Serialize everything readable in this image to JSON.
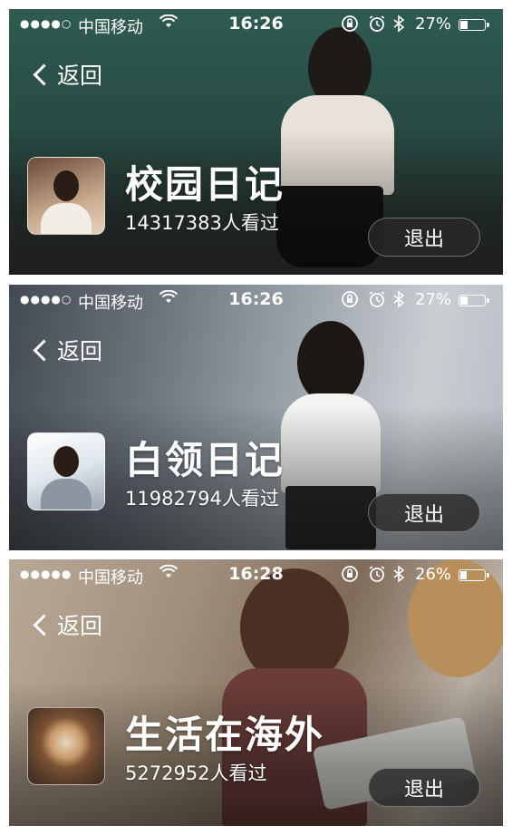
{
  "panels": [
    {
      "status": {
        "carrier": "中国移动",
        "time": "16:26",
        "battery": "27%",
        "battery_level": 0.27,
        "signal_dots": "●●●●○"
      },
      "back_label": "返回",
      "title": "校园日记",
      "views": "14317383人看过",
      "exit_label": "退出"
    },
    {
      "status": {
        "carrier": "中国移动",
        "time": "16:26",
        "battery": "27%",
        "battery_level": 0.27,
        "signal_dots": "●●●●○"
      },
      "back_label": "返回",
      "title": "白领日记",
      "views": "11982794人看过",
      "exit_label": "退出"
    },
    {
      "status": {
        "carrier": "中国移动",
        "time": "16:28",
        "battery": "26%",
        "battery_level": 0.26,
        "signal_dots": "●●●●●"
      },
      "back_label": "返回",
      "title": "生活在海外",
      "views": "5272952人看过",
      "exit_label": "退出"
    }
  ],
  "icons": {
    "wifi": "wifi-icon",
    "lock": "orientation-lock-icon",
    "alarm": "alarm-icon",
    "bluetooth": "bluetooth-icon",
    "battery": "battery-icon",
    "back": "chevron-left-icon"
  }
}
